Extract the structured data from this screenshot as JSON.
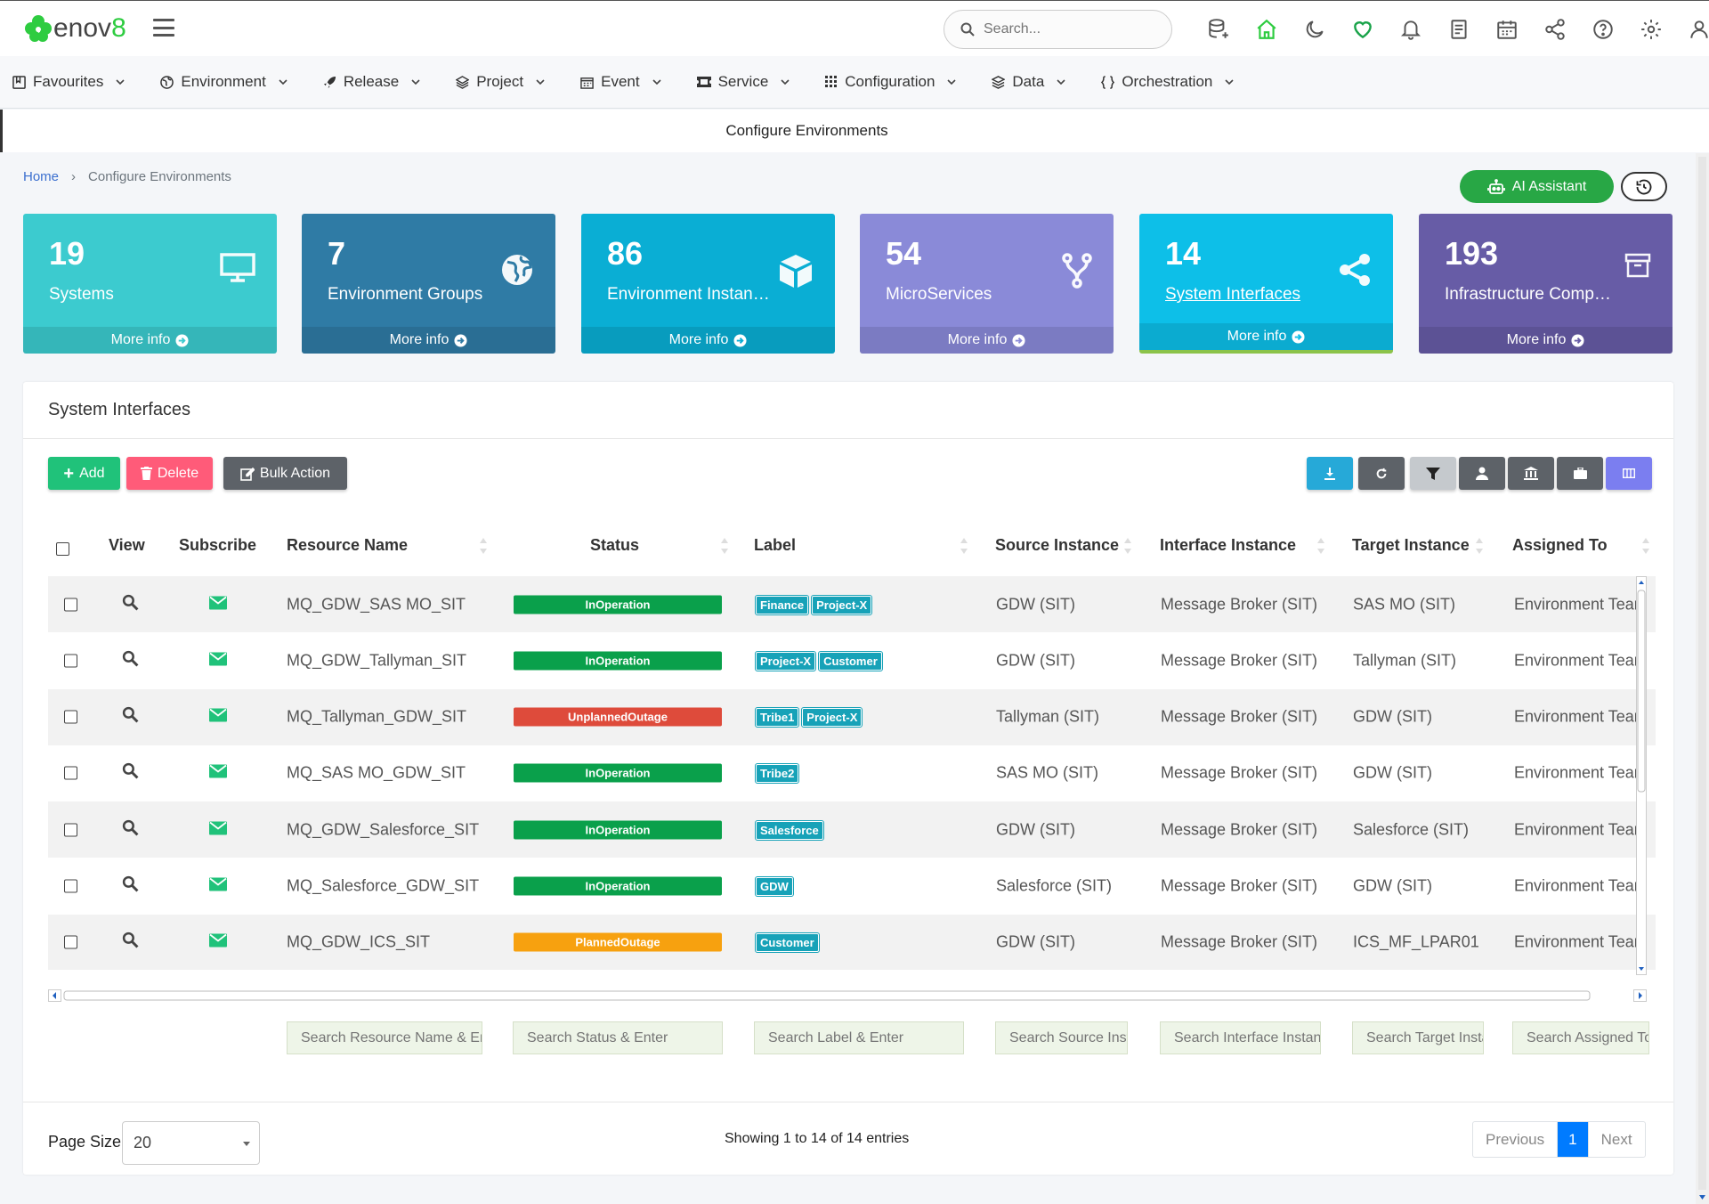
{
  "app": {
    "logo_prefix": "enov",
    "logo_suffix": "8"
  },
  "search": {
    "placeholder": "Search..."
  },
  "top_icons": [
    "database-add-icon",
    "home-icon",
    "moon-icon",
    "heart-icon",
    "bell-icon",
    "document-icon",
    "calendar-icon",
    "share-icon",
    "help-icon",
    "gear-icon",
    "user-icon"
  ],
  "menu": [
    {
      "label": "Favourites",
      "icon": "bookmark-icon"
    },
    {
      "label": "Environment",
      "icon": "globe-icon"
    },
    {
      "label": "Release",
      "icon": "rocket-icon"
    },
    {
      "label": "Project",
      "icon": "layers-icon"
    },
    {
      "label": "Event",
      "icon": "calendar-icon"
    },
    {
      "label": "Service",
      "icon": "ticket-icon"
    },
    {
      "label": "Configuration",
      "icon": "grid-icon"
    },
    {
      "label": "Data",
      "icon": "stack-icon"
    },
    {
      "label": "Orchestration",
      "icon": "braces-icon"
    }
  ],
  "page_title": "Configure Environments",
  "breadcrumb": {
    "home": "Home",
    "current": "Configure Environments"
  },
  "ai_assistant": "AI Assistant",
  "cards": [
    {
      "count": "19",
      "label": "Systems",
      "more": "More info",
      "color": "#3ccbcf",
      "icon": "monitor-icon"
    },
    {
      "count": "7",
      "label": "Environment Groups",
      "more": "More info",
      "color": "#2f7ba5",
      "icon": "globe-icon"
    },
    {
      "count": "86",
      "label": "Environment Instances",
      "more": "More info",
      "color": "#0aaed4",
      "icon": "cube-icon"
    },
    {
      "count": "54",
      "label": "MicroServices",
      "more": "More info",
      "color": "#8a8ad8",
      "icon": "fork-icon"
    },
    {
      "count": "14",
      "label": "System Interfaces",
      "more": "More info",
      "color": "#0dbfe8",
      "icon": "share-icon"
    },
    {
      "count": "193",
      "label": "Infrastructure Components",
      "more": "More info",
      "color": "#675ca6",
      "icon": "archive-icon"
    }
  ],
  "panel_title": "System Interfaces",
  "actions": {
    "add": "Add",
    "delete": "Delete",
    "bulk": "Bulk Action"
  },
  "columns": {
    "view": "View",
    "subscribe": "Subscribe",
    "resource": "Resource Name",
    "status": "Status",
    "label": "Label",
    "source": "Source Instance",
    "interface": "Interface Instance",
    "target": "Target Instance",
    "assigned": "Assigned To"
  },
  "rows": [
    {
      "resource": "MQ_GDW_SAS MO_SIT",
      "status": "InOperation",
      "status_color": "#0aa04b",
      "labels": [
        "Finance",
        "Project-X"
      ],
      "source": "GDW (SIT)",
      "interface": "Message Broker (SIT)",
      "target": "SAS MO (SIT)",
      "assigned": "Environment Team"
    },
    {
      "resource": "MQ_GDW_Tallyman_SIT",
      "status": "InOperation",
      "status_color": "#0aa04b",
      "labels": [
        "Project-X",
        "Customer"
      ],
      "source": "GDW (SIT)",
      "interface": "Message Broker (SIT)",
      "target": "Tallyman (SIT)",
      "assigned": "Environment Team"
    },
    {
      "resource": "MQ_Tallyman_GDW_SIT",
      "status": "UnplannedOutage",
      "status_color": "#de4b3b",
      "labels": [
        "Tribe1",
        "Project-X"
      ],
      "source": "Tallyman (SIT)",
      "interface": "Message Broker (SIT)",
      "target": "GDW (SIT)",
      "assigned": "Environment Team"
    },
    {
      "resource": "MQ_SAS MO_GDW_SIT",
      "status": "InOperation",
      "status_color": "#0aa04b",
      "labels": [
        "Tribe2"
      ],
      "source": "SAS MO (SIT)",
      "interface": "Message Broker (SIT)",
      "target": "GDW (SIT)",
      "assigned": "Environment Team"
    },
    {
      "resource": "MQ_GDW_Salesforce_SIT",
      "status": "InOperation",
      "status_color": "#0aa04b",
      "labels": [
        "Salesforce"
      ],
      "source": "GDW (SIT)",
      "interface": "Message Broker (SIT)",
      "target": "Salesforce (SIT)",
      "assigned": "Environment Team"
    },
    {
      "resource": "MQ_Salesforce_GDW_SIT",
      "status": "InOperation",
      "status_color": "#0aa04b",
      "labels": [
        "GDW"
      ],
      "source": "Salesforce (SIT)",
      "interface": "Message Broker (SIT)",
      "target": "GDW (SIT)",
      "assigned": "Environment Team"
    },
    {
      "resource": "MQ_GDW_ICS_SIT",
      "status": "PlannedOutage",
      "status_color": "#f7a10f",
      "labels": [
        "Customer"
      ],
      "source": "GDW (SIT)",
      "interface": "Message Broker (SIT)",
      "target": "ICS_MF_LPAR01",
      "assigned": "Environment Team"
    }
  ],
  "filters": {
    "resource": "Search Resource Name & Enter",
    "status": "Search Status & Enter",
    "label": "Search Label & Enter",
    "source": "Search Source Instance & Enter",
    "interface": "Search Interface Instance & Enter",
    "target": "Search Target Instance & Enter",
    "assigned": "Search Assigned To & Enter"
  },
  "pager": {
    "page_size_label": "Page Size",
    "page_size": "20",
    "showing": "Showing 1 to 14 of 14 entries",
    "previous": "Previous",
    "current": "1",
    "next": "Next"
  }
}
